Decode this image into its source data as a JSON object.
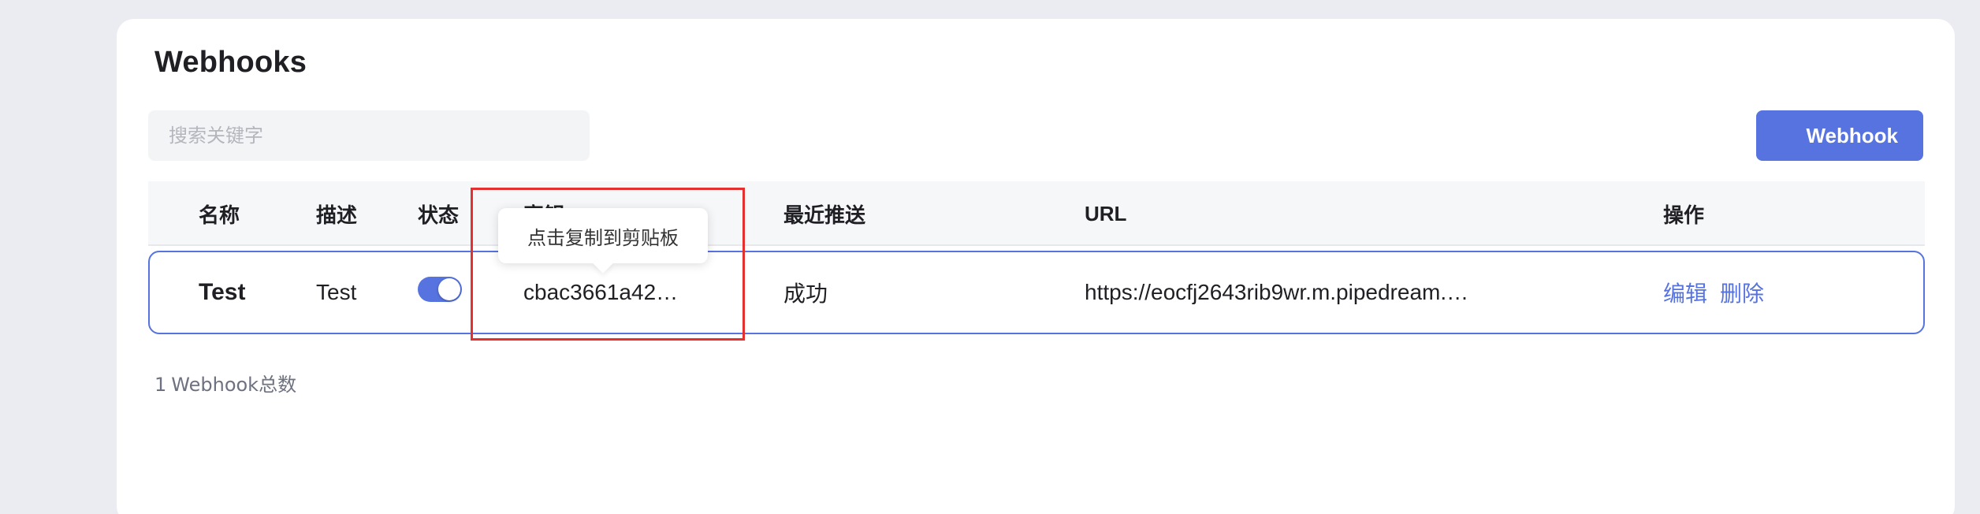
{
  "page": {
    "title": "Webhooks"
  },
  "search": {
    "placeholder": "搜索关键字"
  },
  "toolbar": {
    "add_label": "Webhook"
  },
  "table": {
    "headers": {
      "name": "名称",
      "description": "描述",
      "status": "状态",
      "secret": "密钥",
      "last_push": "最近推送",
      "url": "URL",
      "actions": "操作"
    },
    "rows": [
      {
        "name": "Test",
        "description": "Test",
        "enabled": true,
        "secret": "cbac3661a42…",
        "last_push": "成功",
        "url": "https://eocfj2643rib9wr.m.pipedream.…",
        "edit_label": "编辑",
        "delete_label": "删除"
      }
    ]
  },
  "tooltip": {
    "text": "点击复制到剪贴板"
  },
  "footer": {
    "count": "1",
    "count_label": "Webhook总数"
  },
  "colors": {
    "accent": "#5673e0",
    "highlight": "#e53030",
    "background": "#ebebf2"
  }
}
